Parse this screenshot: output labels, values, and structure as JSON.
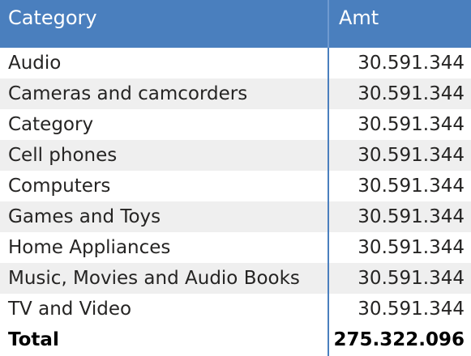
{
  "table": {
    "headers": {
      "category": "Category",
      "amount": "Amt"
    },
    "rows": [
      {
        "category": "Audio",
        "amount": "30.591.344"
      },
      {
        "category": "Cameras and camcorders",
        "amount": "30.591.344"
      },
      {
        "category": "Category",
        "amount": "30.591.344"
      },
      {
        "category": "Cell phones",
        "amount": "30.591.344"
      },
      {
        "category": "Computers",
        "amount": "30.591.344"
      },
      {
        "category": "Games and Toys",
        "amount": "30.591.344"
      },
      {
        "category": "Home Appliances",
        "amount": "30.591.344"
      },
      {
        "category": "Music, Movies and Audio Books",
        "amount": "30.591.344"
      },
      {
        "category": "TV and Video",
        "amount": "30.591.344"
      }
    ],
    "total": {
      "label": "Total",
      "amount": "275.322.096"
    }
  },
  "colors": {
    "header_bg": "#4a7fbe",
    "alt_row_bg": "#efefef",
    "divider": "#4a7fbe"
  }
}
